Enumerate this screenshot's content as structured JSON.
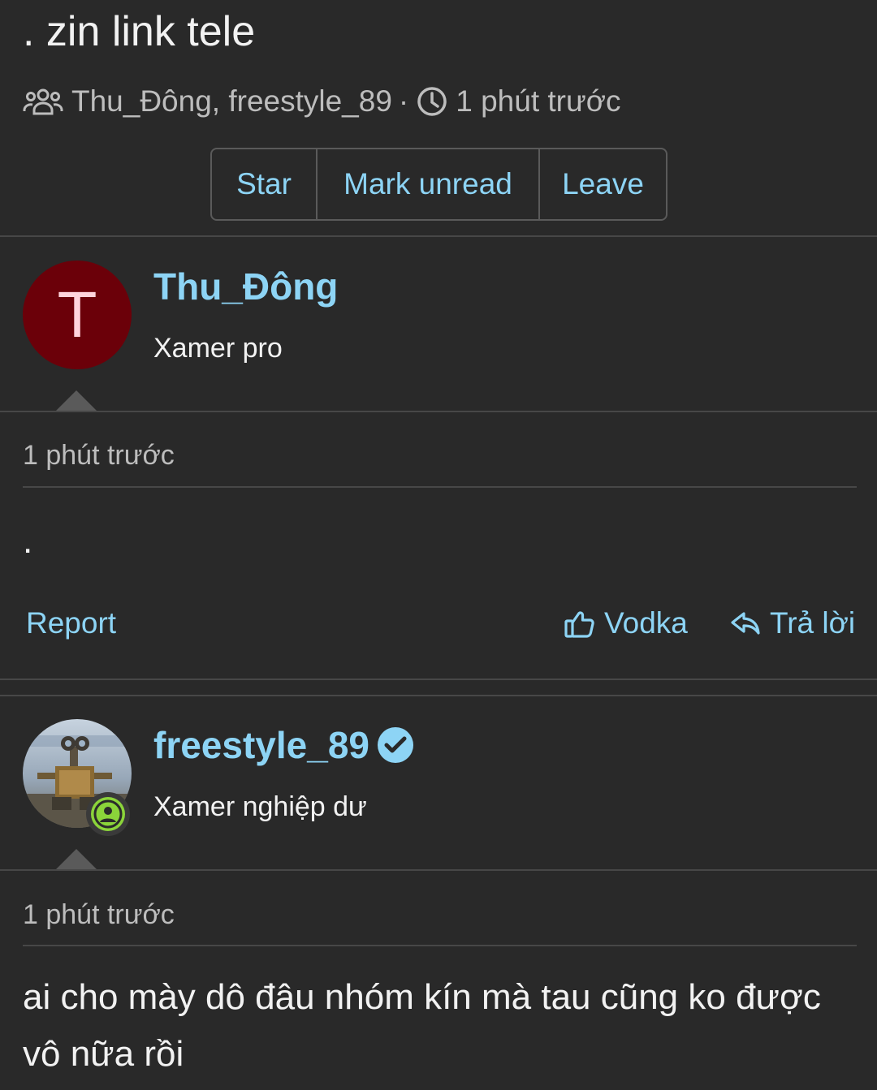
{
  "thread": {
    "title": ". zin link tele",
    "participants": "Thu_Đông, freestyle_89",
    "separator": "·",
    "time": "1 phút trước",
    "buttons": {
      "star": "Star",
      "mark_unread": "Mark unread",
      "leave": "Leave"
    }
  },
  "messages": [
    {
      "avatar_letter": "T",
      "avatar_color": "#6b0009",
      "username": "Thu_Đông",
      "user_title": "Xamer pro",
      "time": "1 phút trước",
      "body": ".",
      "actions": {
        "report": "Report",
        "like": "Vodka",
        "reply": "Trả lời"
      }
    },
    {
      "username": "freestyle_89",
      "verified": true,
      "online": true,
      "user_title": "Xamer nghiệp dư",
      "time": "1 phút trước",
      "body": "ai cho mày dô đâu nhóm kín mà tau cũng ko được vô nữa rồi"
    }
  ],
  "icons": {
    "participants": "users-icon",
    "time": "clock-icon",
    "like": "thumbs-up-icon",
    "reply": "reply-icon",
    "verified": "verified-check-icon",
    "online": "online-user-icon"
  },
  "colors": {
    "background": "#292929",
    "accent": "#8dd4f5",
    "online": "#8bd43a"
  }
}
